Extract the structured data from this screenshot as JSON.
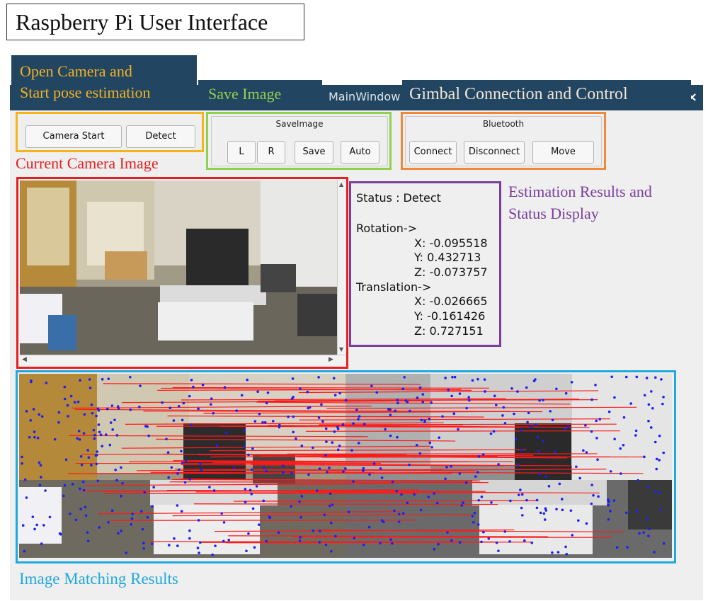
{
  "figure_title": "Raspberry Pi  User Interface",
  "annotations": {
    "camera": [
      "Open Camera and",
      "Start pose estimation"
    ],
    "save": "Save Image",
    "gimbal": "Gimbal Connection and Control",
    "current_image": "Current Camera Image",
    "estimation": [
      "Estimation Results and",
      "Status Display"
    ],
    "matching": "Image Matching Results"
  },
  "window": {
    "title": "MainWindow",
    "close_glyph": "×"
  },
  "camera_group": {
    "start_label": "Camera Start",
    "detect_label": "Detect"
  },
  "save_group": {
    "title": "SaveImage",
    "buttons": [
      "L",
      "R",
      "Save",
      "Auto"
    ]
  },
  "bluetooth_group": {
    "title": "Bluetooth",
    "buttons": [
      "Connect",
      "Disconnect",
      "Move"
    ]
  },
  "status_panel": {
    "status": "Status : Detect",
    "rotation_label": "Rotation->",
    "rotation": {
      "x": "X: -0.095518",
      "y": "Y: 0.432713",
      "z": "Z: -0.073757"
    },
    "translation_label": "Translation->",
    "translation": {
      "x": "X: -0.026665",
      "y": "Y: -0.161426",
      "z": "Z: 0.727151"
    }
  },
  "scrollbar_glyphs": {
    "up": "▲",
    "down": "▼",
    "left": "◀",
    "right": "▶"
  },
  "colors": {
    "banner_bg": "#224562",
    "camera_frame": "#f5b51a",
    "save_frame": "#8fd14f",
    "gimbal_frame": "#f08a3a",
    "current_frame": "#e62020",
    "status_frame": "#7a3e9c",
    "matching_frame": "#20a8df",
    "keypoint": "#1f1ff0",
    "match_line": "#ff1a1a"
  }
}
